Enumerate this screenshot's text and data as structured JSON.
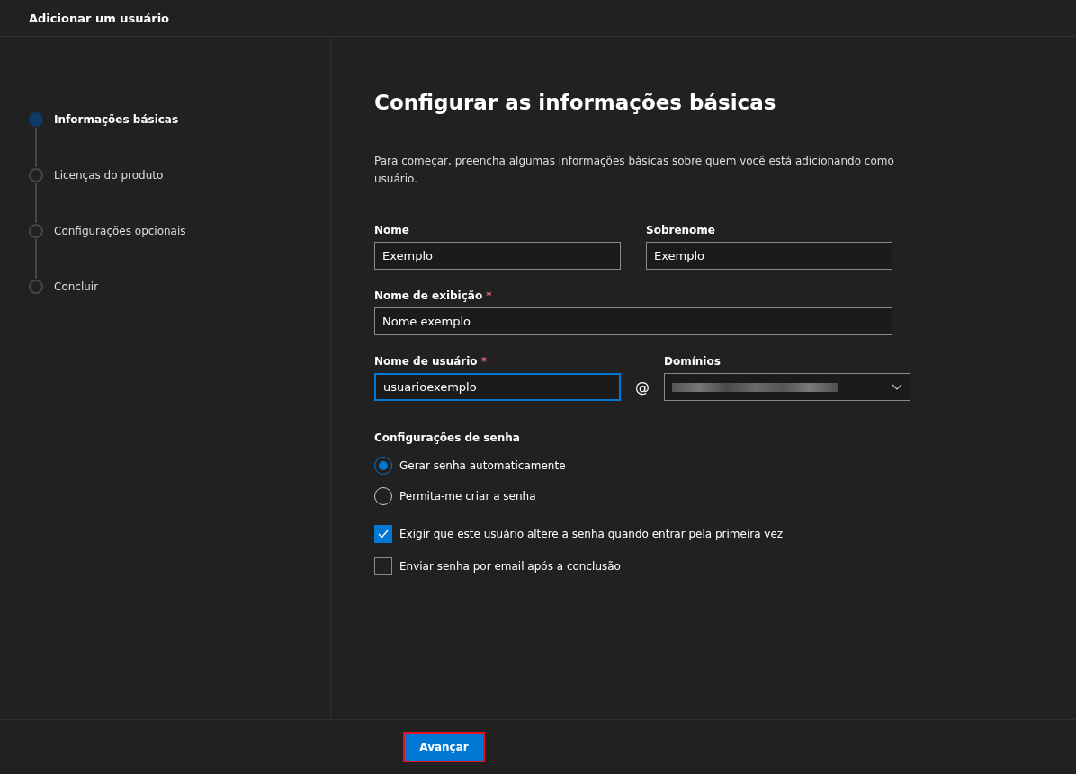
{
  "window": {
    "title": "Adicionar um usuário"
  },
  "steps": [
    {
      "label": "Informações básicas",
      "selected": true
    },
    {
      "label": "Licenças do produto",
      "selected": false
    },
    {
      "label": "Configurações opcionais",
      "selected": false
    },
    {
      "label": "Concluir",
      "selected": false
    }
  ],
  "heading": "Configurar as informações básicas",
  "intro": "Para começar, preencha algumas informações básicas sobre quem você está adicionando como usuário.",
  "first_name": {
    "label": "Nome",
    "value": "Exemplo"
  },
  "last_name": {
    "label": "Sobrenome",
    "value": "Exemplo"
  },
  "display_name": {
    "label": "Nome de exibição",
    "required_mark": "*",
    "value": "Nome exemplo"
  },
  "username": {
    "label": "Nome de usuário",
    "required_mark": "*",
    "value": "usuarioexemplo",
    "focused": true
  },
  "at_sign": "@",
  "domains": {
    "label": "Domínios"
  },
  "password_settings": {
    "label": "Configurações de senha",
    "options": [
      {
        "label": "Gerar senha automaticamente",
        "selected": true
      },
      {
        "label": "Permita-me criar a senha",
        "selected": false
      }
    ]
  },
  "checkboxes": [
    {
      "label": "Exigir que este usuário altere a senha quando entrar pela primeira vez",
      "checked": true
    },
    {
      "label": "Enviar senha por email após a conclusão",
      "checked": false
    }
  ],
  "next_button": "Avançar"
}
